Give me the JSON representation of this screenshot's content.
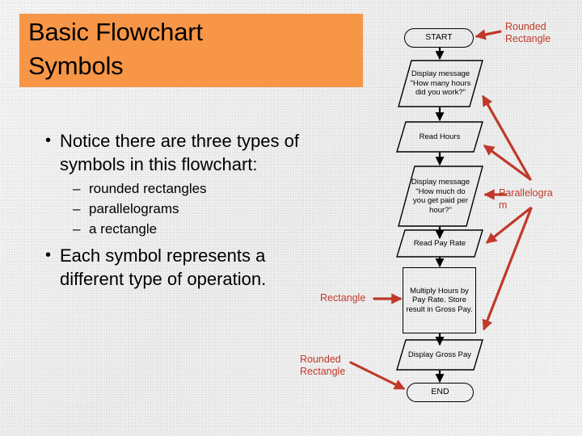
{
  "slide": {
    "title": "Basic Flowchart\nSymbols",
    "title_bg_color": "#F79646",
    "background_color": "#EEEEEE",
    "annotation_color": "#C0392B"
  },
  "body": {
    "bullet1": {
      "marker": "•",
      "text": "Notice there are three types of symbols in this flowchart:"
    },
    "sub_bullets": [
      {
        "marker": "–",
        "text": "rounded rectangles"
      },
      {
        "marker": "–",
        "text": "parallelograms"
      },
      {
        "marker": "–",
        "text": "a rectangle"
      }
    ],
    "bullet2": {
      "marker": "•",
      "text": "Each symbol represents a different type of operation."
    }
  },
  "flowchart": {
    "nodes": [
      {
        "id": "start",
        "shape": "rounded-rectangle",
        "text": "START"
      },
      {
        "id": "display1",
        "shape": "parallelogram",
        "text": "Display message \"How many hours did you work?\""
      },
      {
        "id": "read_hours",
        "shape": "parallelogram",
        "text": "Read Hours"
      },
      {
        "id": "display2",
        "shape": "parallelogram",
        "text": "Display message \"How much do you get paid per hour?\""
      },
      {
        "id": "read_rate",
        "shape": "parallelogram",
        "text": "Read Pay Rate"
      },
      {
        "id": "multiply",
        "shape": "rectangle",
        "text": "Multiply Hours by Pay Rate. Store result in Gross Pay."
      },
      {
        "id": "display3",
        "shape": "parallelogram",
        "text": "Display Gross Pay"
      },
      {
        "id": "end",
        "shape": "rounded-rectangle",
        "text": "END"
      }
    ]
  },
  "annotations": [
    {
      "id": "rounded-rectangle-top",
      "text": "Rounded\nRectangle"
    },
    {
      "id": "parallelogram",
      "text": "Parallelogra\nm"
    },
    {
      "id": "rectangle",
      "text": "Rectangle"
    },
    {
      "id": "rounded-rectangle-bottom",
      "text": "Rounded\nRectangle"
    }
  ]
}
